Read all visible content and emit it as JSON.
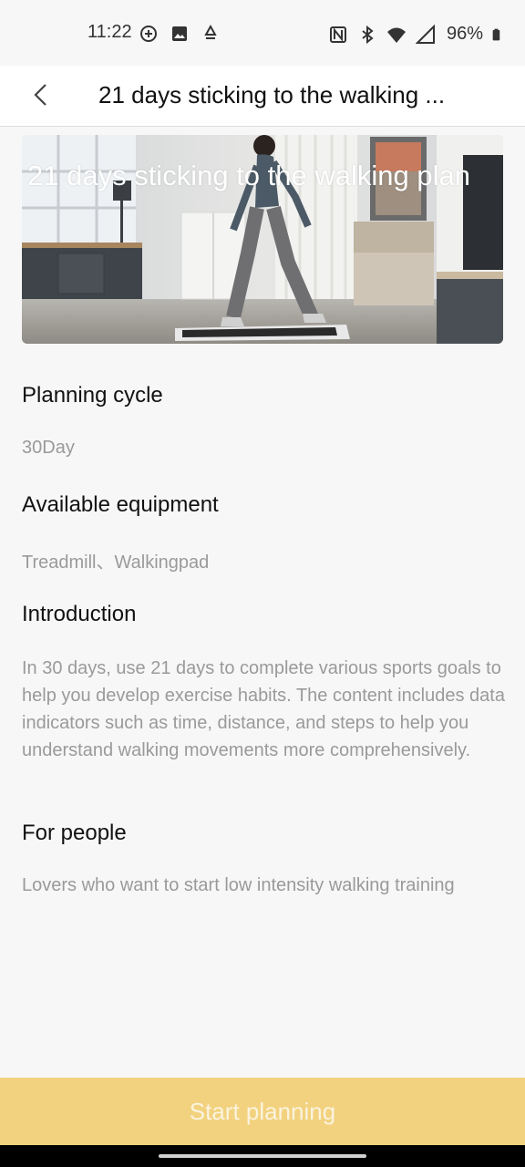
{
  "status_bar": {
    "time": "11:22",
    "battery": "96%",
    "icons_left": [
      "chat-icon",
      "image-icon",
      "location-icon"
    ],
    "icons_right": [
      "nfc-icon",
      "bluetooth-icon",
      "wifi-icon",
      "signal-icon",
      "battery-icon"
    ]
  },
  "header": {
    "title": "21 days sticking to the walking ...",
    "back_icon": "chevron-left-icon"
  },
  "hero": {
    "title": "21 days sticking to the walking plan"
  },
  "sections": {
    "planning_cycle": {
      "heading": "Planning cycle",
      "value": "30Day"
    },
    "equipment": {
      "heading": "Available equipment",
      "value": "Treadmill、Walkingpad"
    },
    "introduction": {
      "heading": "Introduction",
      "text": "In 30 days, use 21 days to complete various sports goals to help you develop exercise habits. The content includes data indicators such as time, distance, and steps to help you understand walking movements more comprehensively."
    },
    "people": {
      "heading": "For people",
      "value": "Lovers who want to start low intensity walking training"
    }
  },
  "footer": {
    "start_label": "Start planning"
  },
  "colors": {
    "accent": "#f2d27e",
    "muted_text": "#9a9a9a"
  }
}
